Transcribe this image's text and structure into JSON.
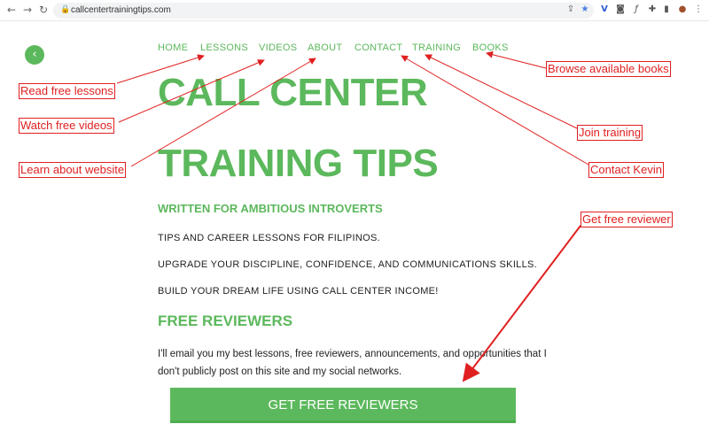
{
  "browser": {
    "back": "←",
    "forward": "→",
    "reload": "↻",
    "lock": "🔒",
    "url": "callcentertrainingtips.com",
    "icons": [
      "share-icon",
      "bookmark-star-icon",
      "extension-v-icon",
      "camera-icon",
      "formula-icon",
      "puzzle-icon",
      "sidebar-icon",
      "avatar",
      "menu-icon"
    ],
    "icon_glyphs": [
      "⇪",
      "★",
      "V",
      "◙",
      "ƒ",
      "✚",
      "▮",
      "●",
      "⋮"
    ]
  },
  "site": {
    "back": "‹",
    "nav": [
      "HOME",
      "LESSONS",
      "VIDEOS",
      "ABOUT",
      "CONTACT",
      "TRAINING",
      "BOOKS"
    ],
    "title_line1": "CALL CENTER",
    "title_line2": "TRAINING TIPS",
    "tagline": "WRITTEN FOR AMBITIOUS INTROVERTS",
    "points": [
      "TIPS AND CAREER LESSONS FOR FILIPINOS.",
      "UPGRADE YOUR DISCIPLINE, CONFIDENCE, AND COMMUNICATIONS SKILLS.",
      "BUILD YOUR DREAM LIFE USING CALL CENTER INCOME!"
    ],
    "reviewers_heading": "FREE REVIEWERS",
    "reviewers_text": "I'll email you my best lessons, free reviewers, announcements, and opportunities that I don't publicly post on this site and my social networks.",
    "cta": "GET FREE REVIEWERS"
  },
  "annotations": {
    "read": "Read free lessons",
    "watch": "Watch free videos",
    "learn": "Learn about website",
    "browse": "Browse available books",
    "join": "Join training",
    "contact": "Contact Kevin",
    "reviewer": "Get free reviewer"
  },
  "colors": {
    "brand_green": "#5cb85c",
    "annotation_red": "#e02020"
  }
}
